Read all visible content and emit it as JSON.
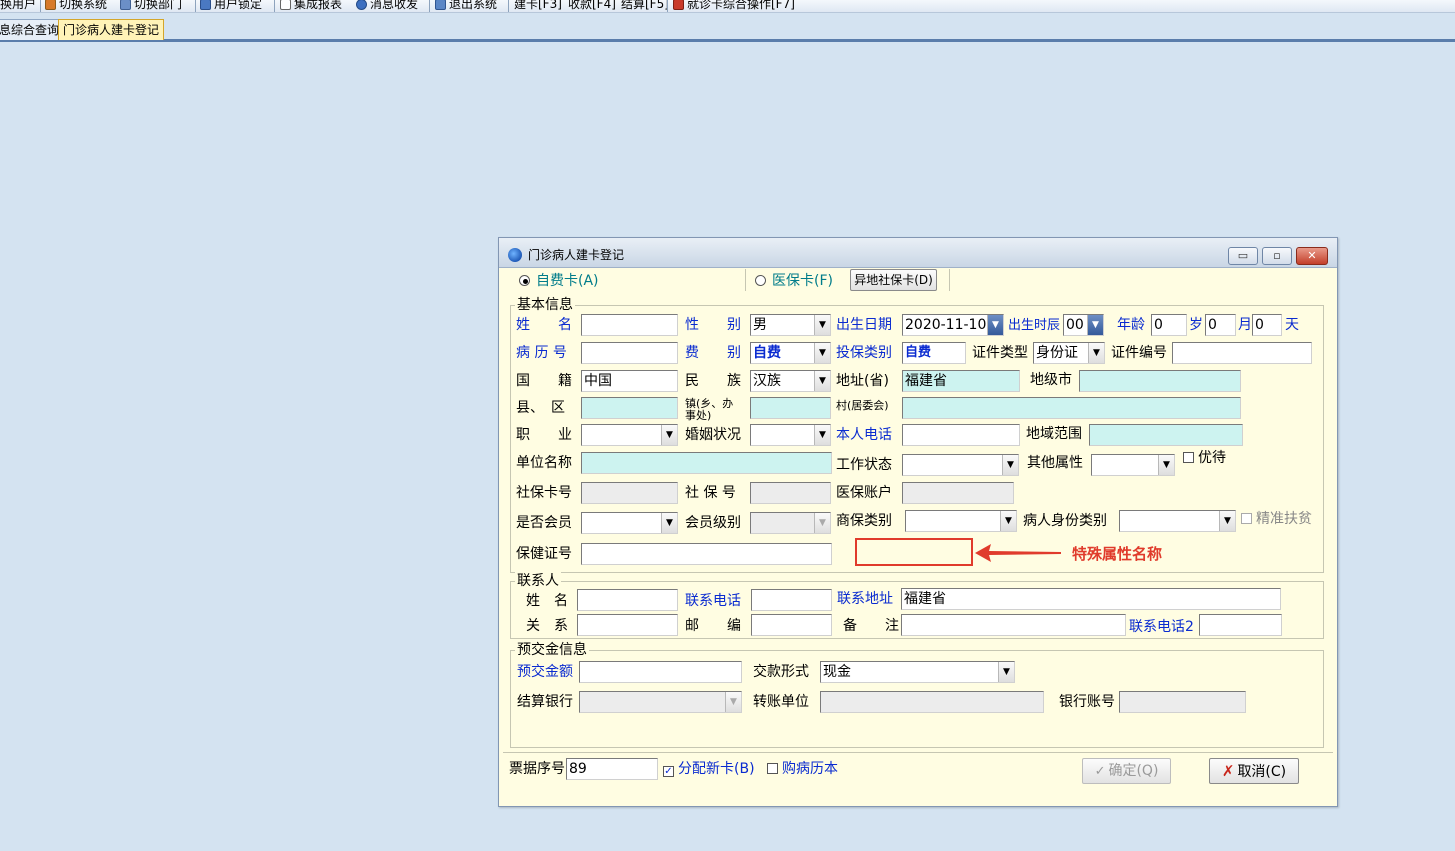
{
  "toolbar": {
    "items": [
      "换用户",
      "切换系统",
      "切换部门",
      "用户锁定",
      "集成报表",
      "消息收发",
      "退出系统",
      "建卡[F3]",
      "收款[F4]",
      "结算[F5]",
      "就诊卡综合操作[F7]"
    ]
  },
  "tabs": [
    "息综合查询",
    "门诊病人建卡登记"
  ],
  "dialog": {
    "title": "门诊病人建卡登记",
    "window_buttons": [
      "▭",
      "▫",
      "✕"
    ],
    "card_type": {
      "self_pay": "自费卡(A)",
      "insurance": "医保卡(F)",
      "remote_btn": "异地社保卡(D)"
    },
    "basic": {
      "legend": "基本信息",
      "name_label": "姓　　名",
      "gender_label": "性　　别",
      "gender_value": "男",
      "birth_label": "出生日期",
      "birth_value": "2020-11-10",
      "birth_time_label": "出生时辰",
      "birth_time_value": "00",
      "age_label": "年龄",
      "age_years": "0",
      "age_years_unit": "岁",
      "age_months": "0",
      "age_months_unit": "月",
      "age_days": "0",
      "age_days_unit": "天",
      "record_label": "病 历 号",
      "fee_label": "费　　别",
      "fee_value": "自费",
      "ins_type_label": "投保类别",
      "ins_type_value": "自费",
      "cert_type_label": "证件类型",
      "cert_type_value": "身份证",
      "cert_no_label": "证件编号",
      "nation_label": "国　　籍",
      "nation_value": "中国",
      "ethnic_label": "民　　族",
      "ethnic_value": "汉族",
      "province_label": "地址(省)",
      "province_value": "福建省",
      "city_label": "地级市",
      "county_label": "县、　区",
      "town_label": "镇(乡、办事处)",
      "village_label": "村(居委会)",
      "job_label": "职　　业",
      "marriage_label": "婚姻状况",
      "phone_label": "本人电话",
      "region_label": "地域范围",
      "unit_label": "单位名称",
      "work_status_label": "工作状态",
      "other_attr_label": "其他属性",
      "priority_label": "优待",
      "si_card_label": "社保卡号",
      "si_no_label": "社 保 号",
      "ins_account_label": "医保账户",
      "member_label": "是否会员",
      "member_level_label": "会员级别",
      "com_ins_label": "商保类别",
      "patient_id_type_label": "病人身份类别",
      "poverty_label": "精准扶贫",
      "health_no_label": "保健证号"
    },
    "annotation": "特殊属性名称",
    "contact": {
      "legend": "联系人",
      "name_label": "姓　名",
      "phone_label": "联系电话",
      "address_label": "联系地址",
      "address_value": "福建省",
      "relation_label": "关　系",
      "zip_label": "邮　　编",
      "remark_label": "备　　注",
      "phone2_label": "联系电话2"
    },
    "deposit": {
      "legend": "预交金信息",
      "amount_label": "预交金额",
      "pay_mode_label": "交款形式",
      "pay_mode_value": "现金",
      "bank_label": "结算银行",
      "transfer_label": "转账单位",
      "account_label": "银行账号"
    },
    "footer": {
      "receipt_label": "票据序号",
      "receipt_value": "89",
      "assign_new_label": "分配新卡(B)",
      "buy_record_label": "购病历本",
      "ok_label": "确定(Q)",
      "cancel_label": "取消(C)"
    }
  }
}
